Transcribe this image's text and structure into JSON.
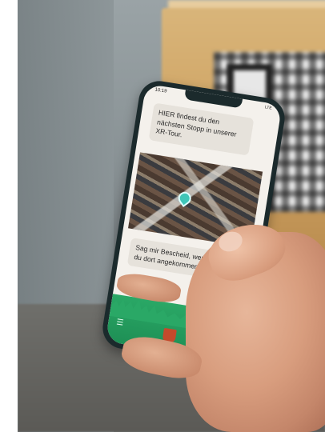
{
  "phone_screen": {
    "status_time": "10:19",
    "status_right": "LTE",
    "message_1": "HIER findest du den nächsten Stopp in unserer XR-Tour.",
    "message_2": "Sag mir Bescheid, wenn du dort angekommen bist!"
  },
  "colors": {
    "footer_green": "#2aa866",
    "bubble_bg": "#e6e2db",
    "crate_wood": "#cfa464",
    "skin": "#d89d7e"
  },
  "icons": [
    "menu-icon",
    "location-pin-icon",
    "crest-icon"
  ]
}
